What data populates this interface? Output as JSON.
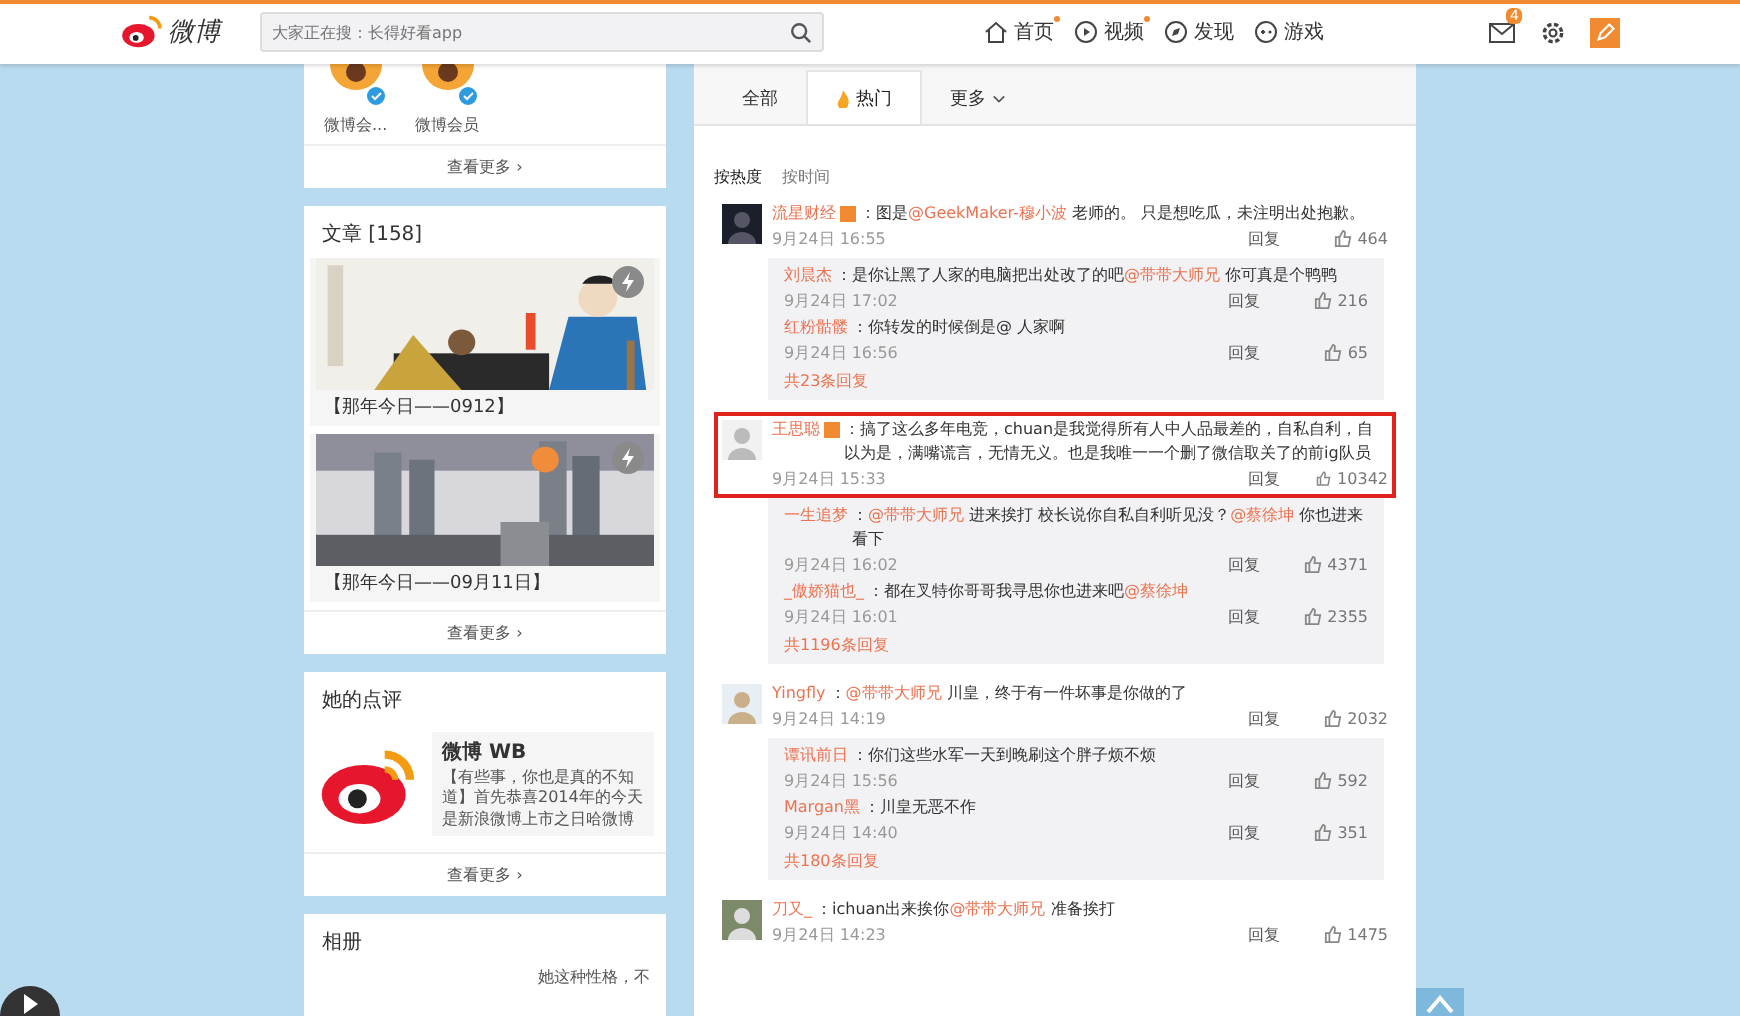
{
  "nav": {
    "logo": "微博",
    "search": {
      "placeholder": "大家正在搜：长得好看app"
    },
    "links": [
      {
        "label": "首页",
        "dot": true
      },
      {
        "label": "视频",
        "dot": true
      },
      {
        "label": "发现",
        "dot": false
      },
      {
        "label": "游戏",
        "dot": false
      }
    ],
    "mail_badge": "4"
  },
  "sidebar": {
    "members": {
      "items": [
        {
          "name": "微博会..."
        },
        {
          "name": "微博会员"
        }
      ],
      "more": "查看更多 ›"
    },
    "articles": {
      "title": "文章 [158]",
      "items": [
        {
          "caption": "【那年今日——0912】"
        },
        {
          "caption": "【那年今日——09月11日】"
        }
      ],
      "more": "查看更多 ›"
    },
    "review": {
      "title": "她的点评",
      "name": "微博 WB",
      "text": "【有些事，你也是真的不知道】首先恭喜2014年的今天是新浪微博上市之日哈微博",
      "more": "查看更多 ›"
    },
    "album": {
      "title": "相册",
      "text": "她这种性格，不"
    }
  },
  "comments": {
    "tabs": [
      {
        "label": "全部",
        "selected": false
      },
      {
        "label": "热门",
        "selected": true
      },
      {
        "label": "更多",
        "selected": false
      }
    ],
    "sort": [
      {
        "label": "按热度",
        "selected": true
      },
      {
        "label": "按时间",
        "selected": false
      }
    ],
    "items": [
      {
        "name": "流星财经",
        "verified": true,
        "highlighted": false,
        "parts": [
          {
            "kind": "text",
            "text": "：图是"
          },
          {
            "kind": "mention",
            "text": "@GeekMaker-穆小波"
          },
          {
            "kind": "text",
            "text": " 老师的。 只是想吃瓜，未注明出处抱歉。"
          }
        ],
        "time": "9月24日 16:55",
        "reply": "回复",
        "likes": "464",
        "replies": [
          {
            "name": "刘晨杰",
            "parts": [
              {
                "kind": "text",
                "text": "：是你让黑了人家的电脑把出处改了的吧"
              },
              {
                "kind": "mention",
                "text": "@带带大师兄"
              },
              {
                "kind": "text",
                "text": " 你可真是个鸭鸭"
              }
            ],
            "time": "9月24日 17:02",
            "reply": "回复",
            "likes": "216"
          },
          {
            "name": "红粉骷髅",
            "parts": [
              {
                "kind": "text",
                "text": "：你转发的时候倒是@ 人家啊"
              }
            ],
            "time": "9月24日 16:56",
            "reply": "回复",
            "likes": "65"
          }
        ],
        "more": "共23条回复"
      },
      {
        "name": "王思聪",
        "verified": true,
        "highlighted": true,
        "parts": [
          {
            "kind": "text",
            "text": "：搞了这么多年电竞，chuan是我觉得所有人中人品最差的，自私自利，自以为是，满嘴谎言，无情无义。也是我唯一一个删了微信取关了的前ig队员"
          }
        ],
        "time": "9月24日 15:33",
        "reply": "回复",
        "likes": "10342",
        "replies": [
          {
            "name": "一生追梦",
            "parts": [
              {
                "kind": "text",
                "text": "："
              },
              {
                "kind": "mention",
                "text": "@带带大师兄"
              },
              {
                "kind": "text",
                "text": " 进来挨打 校长说你自私自利听见没？"
              },
              {
                "kind": "mention",
                "text": "@蔡徐坤"
              },
              {
                "kind": "text",
                "text": " 你也进来看下"
              }
            ],
            "time": "9月24日 16:02",
            "reply": "回复",
            "likes": "4371"
          },
          {
            "name": "_傲娇猫也_",
            "parts": [
              {
                "kind": "text",
                "text": "：都在叉特你哥哥我寻思你也进来吧"
              },
              {
                "kind": "mention",
                "text": "@蔡徐坤"
              }
            ],
            "time": "9月24日 16:01",
            "reply": "回复",
            "likes": "2355"
          }
        ],
        "more": "共1196条回复"
      },
      {
        "name": "Yingfly",
        "verified": false,
        "highlighted": false,
        "parts": [
          {
            "kind": "text",
            "text": "："
          },
          {
            "kind": "mention",
            "text": "@带带大师兄"
          },
          {
            "kind": "text",
            "text": " 川皇，终于有一件坏事是你做的了"
          }
        ],
        "time": "9月24日 14:19",
        "reply": "回复",
        "likes": "2032",
        "replies": [
          {
            "name": "谭讯前日",
            "parts": [
              {
                "kind": "text",
                "text": "：你们这些水军一天到晚刷这个胖子烦不烦"
              }
            ],
            "time": "9月24日 15:56",
            "reply": "回复",
            "likes": "592"
          },
          {
            "name": "Margan黑",
            "parts": [
              {
                "kind": "text",
                "text": "：川皇无恶不作"
              }
            ],
            "time": "9月24日 14:40",
            "reply": "回复",
            "likes": "351"
          }
        ],
        "more": "共180条回复"
      },
      {
        "name": "刀又_",
        "verified": false,
        "highlighted": false,
        "parts": [
          {
            "kind": "text",
            "text": "：ichuan出来挨你"
          },
          {
            "kind": "mention",
            "text": "@带带大师兄"
          },
          {
            "kind": "text",
            "text": " 准备挨打"
          }
        ],
        "time": "9月24日 14:23",
        "reply": "回复",
        "likes": "1475"
      }
    ]
  }
}
